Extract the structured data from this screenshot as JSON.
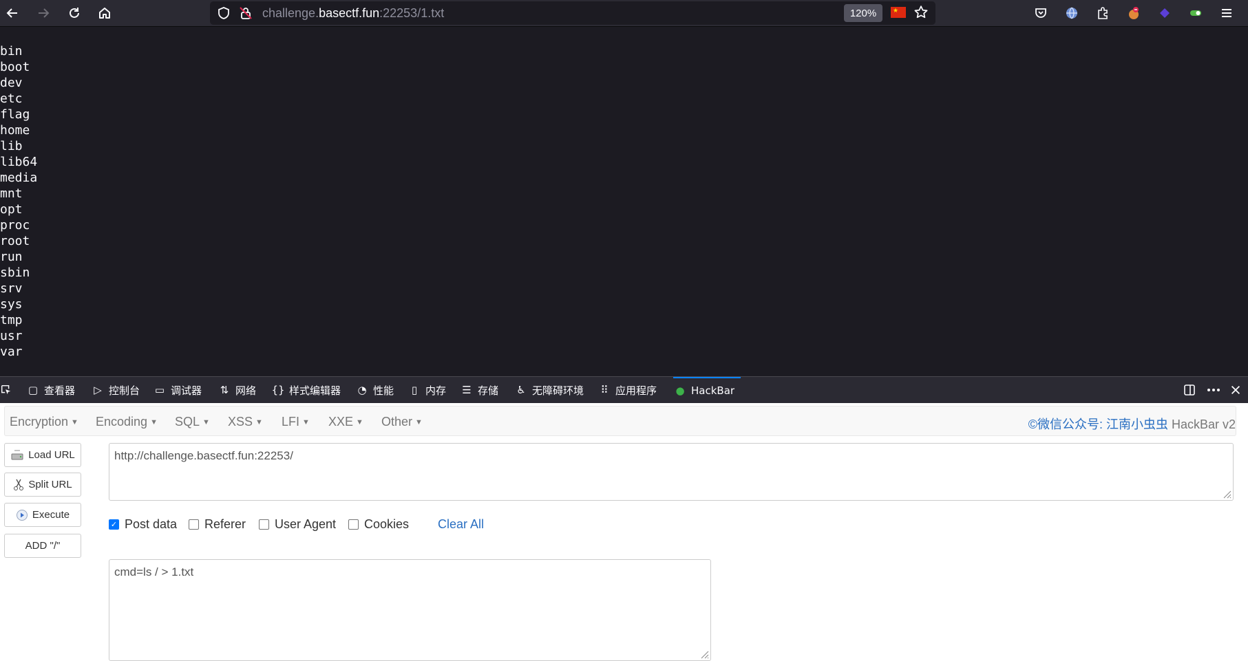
{
  "browser": {
    "url_prefix": "challenge.",
    "url_domain": "basectf.fun",
    "url_suffix": ":22253/1.txt",
    "zoom": "120%",
    "flag_star": "★"
  },
  "page": {
    "lines": [
      "bin",
      "boot",
      "dev",
      "etc",
      "flag",
      "home",
      "lib",
      "lib64",
      "media",
      "mnt",
      "opt",
      "proc",
      "root",
      "run",
      "sbin",
      "srv",
      "sys",
      "tmp",
      "usr",
      "var"
    ]
  },
  "devtools": {
    "tabs": [
      {
        "icon": "▢",
        "label": "查看器"
      },
      {
        "icon": "▷",
        "label": "控制台"
      },
      {
        "icon": "▭",
        "label": "调试器"
      },
      {
        "icon": "⇅",
        "label": "网络"
      },
      {
        "icon": "{}",
        "label": "样式编辑器"
      },
      {
        "icon": "◔",
        "label": "性能"
      },
      {
        "icon": "▯",
        "label": "内存"
      },
      {
        "icon": "☰",
        "label": "存储"
      },
      {
        "icon": "♿",
        "label": "无障碍环境"
      },
      {
        "icon": "⠿",
        "label": "应用程序"
      },
      {
        "icon": "●",
        "label": "HackBar"
      }
    ]
  },
  "hackbar": {
    "menus": [
      "Encryption",
      "Encoding",
      "SQL",
      "XSS",
      "LFI",
      "XXE",
      "Other"
    ],
    "brand_cn": "©微信公众号: 江南小虫虫",
    "brand_en": " HackBar v2",
    "buttons": {
      "load": "Load URL",
      "split": "Split URL",
      "execute": "Execute",
      "add": "ADD \"/\""
    },
    "url_value": "http://challenge.basectf.fun:22253/",
    "options": {
      "post": "Post data",
      "referer": "Referer",
      "ua": "User Agent",
      "cookies": "Cookies",
      "clear": "Clear All"
    },
    "post_value": "cmd=ls / > 1.txt"
  },
  "colors": {
    "accent": "#0a84ff",
    "link": "#2a6fc2",
    "page_bg": "#1c1b22",
    "toolbar_bg": "#2b2a33"
  }
}
